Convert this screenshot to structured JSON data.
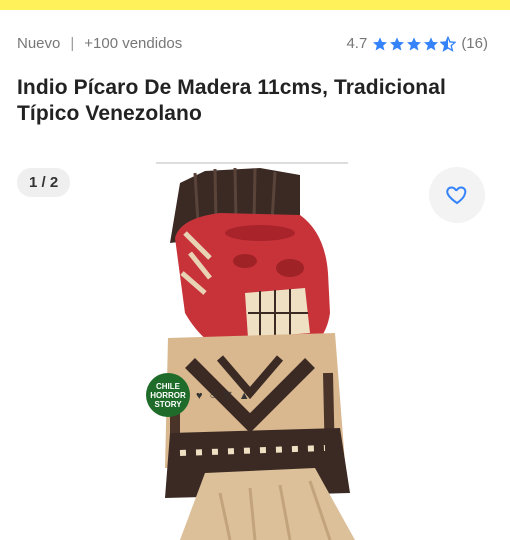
{
  "header": {
    "condition": "Nuevo",
    "separator": "|",
    "sold": "+100 vendidos",
    "rating": "4.7",
    "reviews": "(16)",
    "star_color": "#3483fa"
  },
  "product": {
    "title": "Indio Pícaro De Madera 11cms, Tradicional Típico Venezolano"
  },
  "gallery": {
    "counter": "1 / 2",
    "favorite_icon": "heart-icon",
    "watermark_lines": [
      "CHILE",
      "HORROR",
      "STORY"
    ],
    "watermark_icons": "♥ ○ ▽ ▲"
  },
  "colors": {
    "topbar": "#fff159",
    "accent": "#3483fa"
  }
}
